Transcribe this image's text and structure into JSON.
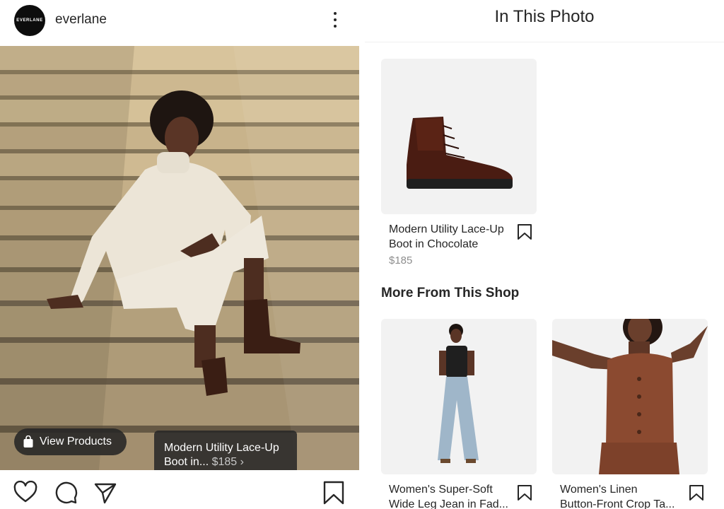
{
  "account": {
    "username": "everlane",
    "avatar_text": "EVERLANE"
  },
  "post": {
    "tag_title": "Modern Utility Lace-Up",
    "tag_line2": "Boot in...",
    "tag_price": "$185",
    "view_products_label": "View Products"
  },
  "panel": {
    "title": "In This Photo",
    "featured": {
      "title_line1": "Modern Utility Lace-Up",
      "title_line2": "Boot in Chocolate",
      "price": "$185"
    },
    "more_title": "More From This Shop",
    "more_items": [
      {
        "title_line1": "Women's Super-Soft",
        "title_line2": "Wide Leg Jean in Fad..."
      },
      {
        "title_line1": "Women's Linen",
        "title_line2": "Button-Front Crop Ta..."
      }
    ]
  },
  "icons": {
    "like": "heart-icon",
    "comment": "comment-icon",
    "share": "send-icon",
    "save": "bookmark-icon",
    "more": "more-vertical-icon",
    "bag": "shopping-bag-icon"
  },
  "colors": {
    "text": "#262626",
    "muted": "#8e8e8e",
    "tag_bg": "#262626",
    "card_bg": "#f2f2f2"
  }
}
